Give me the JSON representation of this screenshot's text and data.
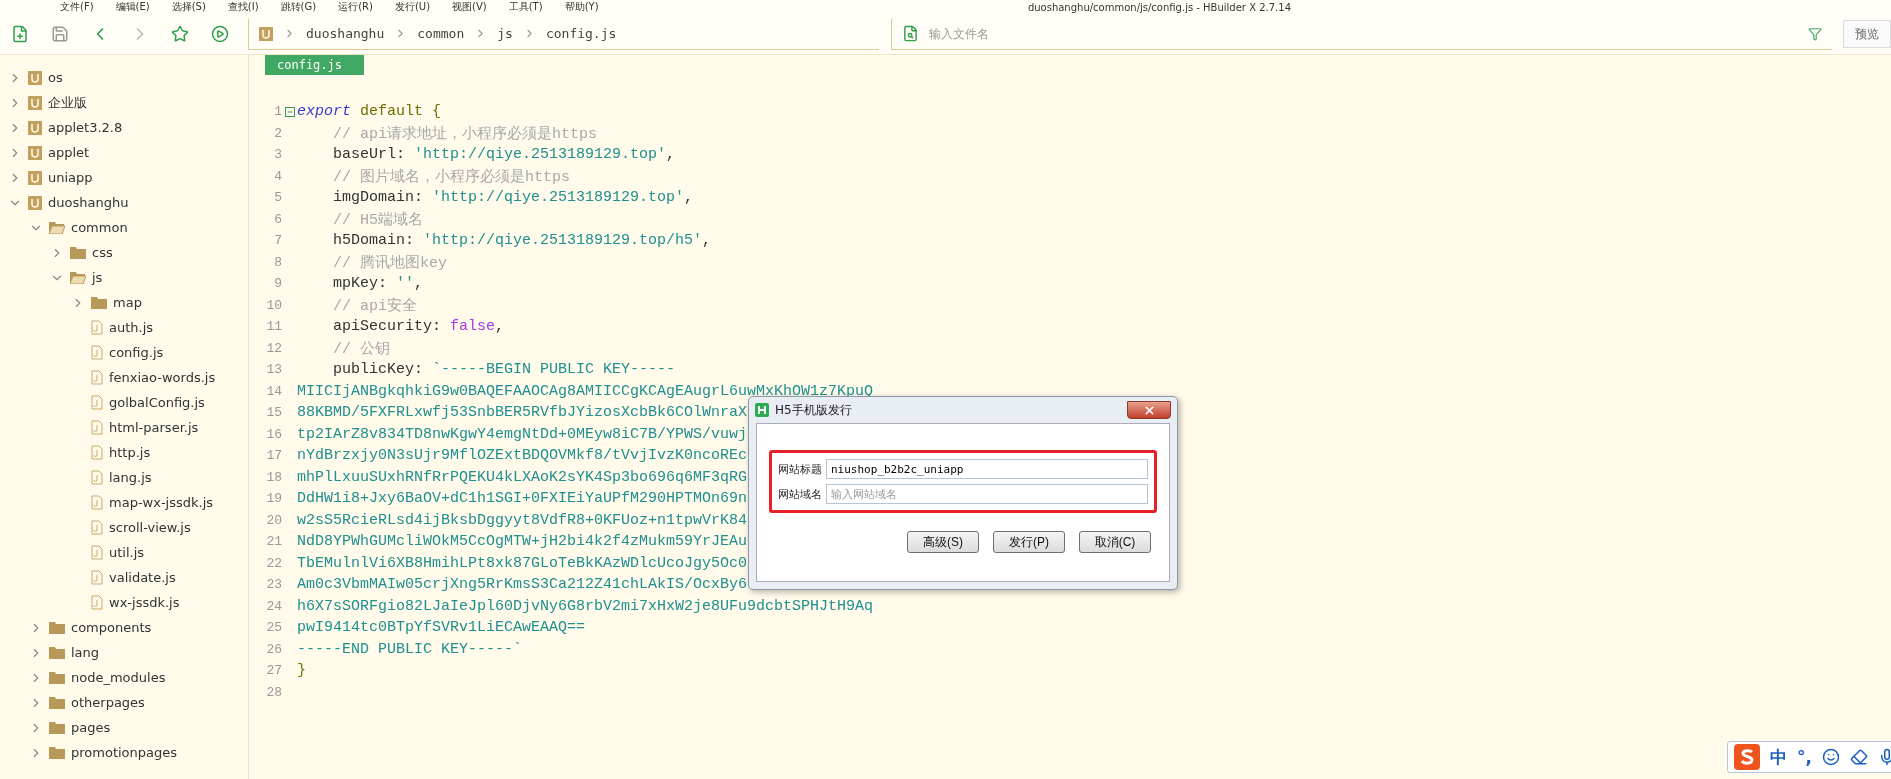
{
  "menu": [
    "文件(F)",
    "编辑(E)",
    "选择(S)",
    "查找(I)",
    "跳转(G)",
    "运行(R)",
    "发行(U)",
    "视图(V)",
    "工具(T)",
    "帮助(Y)"
  ],
  "window_title": "duoshanghu/common/js/config.js - HBuilder X 2.7.14",
  "breadcrumbs": [
    "duoshanghu",
    "common",
    "js",
    "config.js"
  ],
  "file_search": {
    "placeholder": "输入文件名"
  },
  "preview_button": "预览",
  "sidebar": {
    "items": [
      {
        "kind": "project",
        "label": "os",
        "expanded": false
      },
      {
        "kind": "project",
        "label": "企业版",
        "expanded": false
      },
      {
        "kind": "project",
        "label": "applet3.2.8",
        "expanded": false
      },
      {
        "kind": "project",
        "label": "applet",
        "expanded": false
      },
      {
        "kind": "project",
        "label": "uniapp",
        "expanded": false
      },
      {
        "kind": "project",
        "label": "duoshanghu",
        "expanded": true,
        "children": [
          {
            "kind": "folder",
            "label": "common",
            "expanded": true,
            "children": [
              {
                "kind": "folder",
                "label": "css",
                "expanded": false
              },
              {
                "kind": "folder",
                "label": "js",
                "expanded": true,
                "children": [
                  {
                    "kind": "folder",
                    "label": "map",
                    "expanded": false
                  },
                  {
                    "kind": "file",
                    "label": "auth.js"
                  },
                  {
                    "kind": "file",
                    "label": "config.js"
                  },
                  {
                    "kind": "file",
                    "label": "fenxiao-words.js"
                  },
                  {
                    "kind": "file",
                    "label": "golbalConfig.js"
                  },
                  {
                    "kind": "file",
                    "label": "html-parser.js"
                  },
                  {
                    "kind": "file",
                    "label": "http.js"
                  },
                  {
                    "kind": "file",
                    "label": "lang.js"
                  },
                  {
                    "kind": "file",
                    "label": "map-wx-jssdk.js"
                  },
                  {
                    "kind": "file",
                    "label": "scroll-view.js"
                  },
                  {
                    "kind": "file",
                    "label": "util.js"
                  },
                  {
                    "kind": "file",
                    "label": "validate.js"
                  },
                  {
                    "kind": "file",
                    "label": "wx-jssdk.js"
                  }
                ]
              }
            ]
          },
          {
            "kind": "folder",
            "label": "components",
            "expanded": false
          },
          {
            "kind": "folder",
            "label": "lang",
            "expanded": false
          },
          {
            "kind": "folder",
            "label": "node_modules",
            "expanded": false
          },
          {
            "kind": "folder",
            "label": "otherpages",
            "expanded": false
          },
          {
            "kind": "folder",
            "label": "pages",
            "expanded": false
          },
          {
            "kind": "folder",
            "label": "promotionpages",
            "expanded": false
          }
        ]
      }
    ]
  },
  "editor_tabs": [
    {
      "label": "config.js",
      "selected": true
    }
  ],
  "code_lines": [
    {
      "number": "1",
      "fold": true,
      "tokens": [
        {
          "kind": "keyword",
          "text": "export"
        },
        {
          "kind": "word",
          "text": " default {"
        }
      ]
    },
    {
      "number": "2",
      "indent": true,
      "tokens": [
        {
          "kind": "comment",
          "text": "// api请求地址，小程序必须是https"
        }
      ]
    },
    {
      "number": "3",
      "indent": true,
      "tokens": [
        {
          "kind": "prop",
          "text": "baseUrl: "
        },
        {
          "kind": "string",
          "text": "'http://qiye.2513189129.top'"
        },
        {
          "kind": "prop",
          "text": ","
        }
      ]
    },
    {
      "number": "4",
      "indent": true,
      "tokens": [
        {
          "kind": "comment",
          "text": "// 图片域名，小程序必须是https"
        }
      ]
    },
    {
      "number": "5",
      "indent": true,
      "tokens": [
        {
          "kind": "prop",
          "text": "imgDomain: "
        },
        {
          "kind": "string",
          "text": "'http://qiye.2513189129.top'"
        },
        {
          "kind": "prop",
          "text": ","
        }
      ]
    },
    {
      "number": "6",
      "indent": true,
      "tokens": [
        {
          "kind": "comment",
          "text": "// H5端域名"
        }
      ]
    },
    {
      "number": "7",
      "indent": true,
      "tokens": [
        {
          "kind": "prop",
          "text": "h5Domain: "
        },
        {
          "kind": "string",
          "text": "'http://qiye.2513189129.top/h5'"
        },
        {
          "kind": "prop",
          "text": ","
        }
      ]
    },
    {
      "number": "8",
      "indent": true,
      "tokens": [
        {
          "kind": "comment",
          "text": "// 腾讯地图key"
        }
      ]
    },
    {
      "number": "9",
      "indent": true,
      "tokens": [
        {
          "kind": "prop",
          "text": "mpKey: "
        },
        {
          "kind": "string",
          "text": "''"
        },
        {
          "kind": "prop",
          "text": ","
        }
      ]
    },
    {
      "number": "10",
      "indent": true,
      "tokens": [
        {
          "kind": "comment",
          "text": "// api安全"
        }
      ]
    },
    {
      "number": "11",
      "indent": true,
      "tokens": [
        {
          "kind": "prop",
          "text": "apiSecurity: "
        },
        {
          "kind": "literal",
          "text": "false"
        },
        {
          "kind": "prop",
          "text": ","
        }
      ]
    },
    {
      "number": "12",
      "indent": true,
      "tokens": [
        {
          "kind": "comment",
          "text": "// 公钥"
        }
      ]
    },
    {
      "number": "13",
      "indent": true,
      "tokens": [
        {
          "kind": "prop",
          "text": "publicKey: "
        },
        {
          "kind": "string",
          "text": "`-----BEGIN PUBLIC KEY-----"
        }
      ]
    },
    {
      "number": "14",
      "tokens": [
        {
          "kind": "string",
          "text": "MIICIjANBgkqhkiG9w0BAQEFAAOCAg8AMIICCgKCAgEAugrL6uwMxKhOW1z7KpuQ"
        }
      ]
    },
    {
      "number": "15",
      "tokens": [
        {
          "kind": "string",
          "text": "88KBMD/5FXFRLxwfj53SnbBER5RVfbJYizosXcbBk6COlWnraX"
        }
      ]
    },
    {
      "number": "16",
      "tokens": [
        {
          "kind": "string",
          "text": "tp2IArZ8v834TD8nwKgwY4emgNtDd+0MEyw8iC7B/YPWS/vuwj"
        }
      ]
    },
    {
      "number": "17",
      "tokens": [
        {
          "kind": "string",
          "text": "nYdBrzxjy0N3sUjr9MflOZExtBDQOVMkf8/tVvjIvzK0ncoREc"
        }
      ]
    },
    {
      "number": "18",
      "tokens": [
        {
          "kind": "string",
          "text": "mhPlLxuuSUxhRNfRrPQEKU4kLXAoK2sYK4Sp3bo696q6MF3qRG"
        }
      ]
    },
    {
      "number": "19",
      "tokens": [
        {
          "kind": "string",
          "text": "DdHW1i8+Jxy6BaOV+dC1h1SGI+0FXIEiYaUPfM290HPTMOn69n"
        }
      ]
    },
    {
      "number": "20",
      "tokens": [
        {
          "kind": "string",
          "text": "w2sS5RcieRLsd4ijBksbDggyyt8VdfR8+0KFUoz+n1tpwVrK84"
        }
      ]
    },
    {
      "number": "21",
      "tokens": [
        {
          "kind": "string",
          "text": "NdD8YPWhGUMcliWOkM5CcOgMTW+jH2bi4k2f4zMukm59YrJEAu"
        }
      ]
    },
    {
      "number": "22",
      "tokens": [
        {
          "kind": "string",
          "text": "TbEMulnlVi6XB8HmihLPt8xk87GLoTeBkKAzWDlcUcoJgy5Oc0"
        }
      ]
    },
    {
      "number": "23",
      "tokens": [
        {
          "kind": "string",
          "text": "Am0c3VbmMAIw05crjXng5RrKmsS3Ca212Z41chLAkIS/OcxBy6"
        }
      ]
    },
    {
      "number": "24",
      "tokens": [
        {
          "kind": "string",
          "text": "h6X7sSORFgio82LJaIeJpl60DjvNy6G8rbV2mi7xHxW2je8UFu9dcbtSPHJtH9Aq"
        }
      ]
    },
    {
      "number": "25",
      "tokens": [
        {
          "kind": "string",
          "text": "pwI9414tc0BTpYfSVRv1LiECAwEAAQ=="
        }
      ]
    },
    {
      "number": "26",
      "tokens": [
        {
          "kind": "string",
          "text": "-----END PUBLIC KEY-----`"
        }
      ]
    },
    {
      "number": "27",
      "tokens": [
        {
          "kind": "word",
          "text": "}"
        }
      ]
    },
    {
      "number": "28"
    }
  ],
  "dialog": {
    "title": "H5手机版发行",
    "fields": [
      {
        "label": "网站标题",
        "value": "niushop_b2b2c_uniapp"
      },
      {
        "label": "网站域名",
        "placeholder": "输入网站域名"
      }
    ],
    "buttons": [
      "高级(S)",
      "发行(P)",
      "取消(C)"
    ]
  },
  "ime_bar": {
    "mode": "中",
    "punctuation": "°,"
  }
}
